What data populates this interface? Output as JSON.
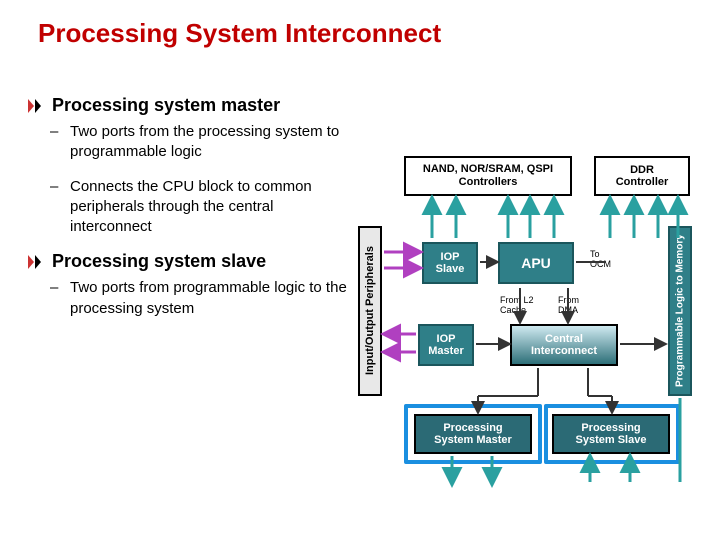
{
  "title": "Processing System Interconnect",
  "section1": {
    "heading": "Processing system master",
    "b1": "Two ports from the processing system to programmable logic",
    "b2": "Connects the CPU block to common peripherals through the central interconnect"
  },
  "section2": {
    "heading": "Processing system slave",
    "b1": "Two ports from programmable logic to the processing system"
  },
  "diagram": {
    "mem_ctrl": "NAND, NOR/SRAM, QSPI\nControllers",
    "ddr": "DDR\nController",
    "io_periph": "Input/Output Peripherals",
    "iop_slave": "IOP\nSlave",
    "apu": "APU",
    "to_ocm": "To OCM",
    "prog_mem": "Programmable Logic to Memory",
    "from_l2": "From L2 Cache",
    "from_dma": "From DMA",
    "iop_master": "IOP\nMaster",
    "central": "Central\nInterconnect",
    "ps_master": "Processing\nSystem Master",
    "ps_slave": "Processing\nSystem Slave"
  }
}
